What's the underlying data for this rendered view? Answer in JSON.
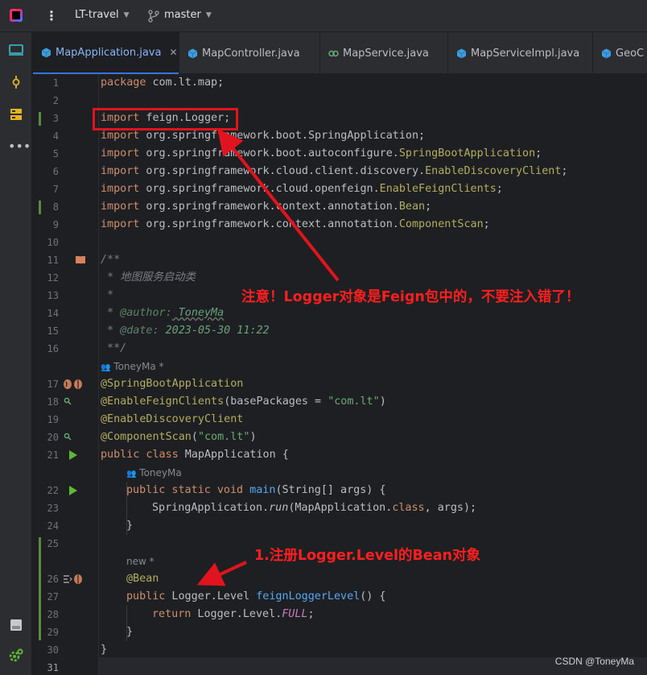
{
  "toolbar": {
    "project": "LT-travel",
    "branch": "master"
  },
  "tabs": [
    {
      "label": "MapApplication.java",
      "icon": "java-class-icon",
      "active": true
    },
    {
      "label": "MapController.java",
      "icon": "java-class-icon",
      "active": false
    },
    {
      "label": "MapService.java",
      "icon": "java-interface-icon",
      "active": false
    },
    {
      "label": "MapServiceImpl.java",
      "icon": "java-class-icon",
      "active": false
    },
    {
      "label": "GeoC",
      "icon": "java-class-icon",
      "active": false
    }
  ],
  "line_numbers": [
    "1",
    "2",
    "3",
    "4",
    "5",
    "6",
    "7",
    "8",
    "9",
    "10",
    "11",
    "12",
    "13",
    "14",
    "15",
    "16",
    "17",
    "18",
    "19",
    "20",
    "21",
    "22",
    "23",
    "24",
    "25",
    "26",
    "27",
    "28",
    "29",
    "30",
    "31"
  ],
  "code": {
    "l1_kw": "package",
    "l1_rest": " com.lt.map;",
    "l3_kw": "import",
    "l3_rest": " feign.Logger;",
    "l4_kw": "import",
    "l4_rest": " org.springframework.boot.SpringApplication;",
    "l5_kw": "import",
    "l5_pre": " org.springframework.boot.autoconfigure.",
    "l5_ann": "SpringBootApplication",
    "l5_end": ";",
    "l6_kw": "import",
    "l6_pre": " org.springframework.cloud.client.discovery.",
    "l6_ann": "EnableDiscoveryClient",
    "l6_end": ";",
    "l7_kw": "import",
    "l7_pre": " org.springframework.cloud.openfeign.",
    "l7_ann": "EnableFeignClients",
    "l7_end": ";",
    "l8_kw": "import",
    "l8_pre": " org.springframework.context.annotation.",
    "l8_ann": "Bean",
    "l8_end": ";",
    "l9_kw": "import",
    "l9_pre": " org.springframework.context.annotation.",
    "l9_ann": "ComponentScan",
    "l9_end": ";",
    "l11": "/**",
    "l12": " * 地图服务启动类",
    "l13": " *",
    "l14_pre": " * ",
    "l14_tag": "@author:",
    "l14_val": " ToneyMa",
    "l15_pre": " * ",
    "l15_tag": "@date:",
    "l15_val": " 2023-05-30 11:22",
    "l16": " **/",
    "inlay_author1": "ToneyMa *",
    "l17": "@SpringBootApplication",
    "l18_ann": "@EnableFeignClients",
    "l18_mid": "(basePackages = ",
    "l18_str": "\"com.lt\"",
    "l18_end": ")",
    "l19": "@EnableDiscoveryClient",
    "l20_ann": "@ComponentScan",
    "l20_mid": "(",
    "l20_str": "\"com.lt\"",
    "l20_end": ")",
    "l21_kw": "public class",
    "l21_rest": " MapApplication {",
    "inlay_author2": "ToneyMa",
    "l22_kw": "public static void",
    "l22_fn": " main",
    "l22_rest": "(String[] args) {",
    "l23_pre": "SpringApplication.",
    "l23_fn": "run",
    "l23_mid": "(MapApplication.",
    "l23_kw": "class",
    "l23_end": ", args);",
    "l24": "}",
    "inlay_new": "new *",
    "l26": "@Bean",
    "l27_kw": "public",
    "l27_mid": " Logger.Level ",
    "l27_fn": "feignLoggerLevel",
    "l27_end": "() {",
    "l28_kw": "return",
    "l28_mid": " Logger.Level.",
    "l28_fld": "FULL",
    "l28_end": ";",
    "l29": "}",
    "l30": "}"
  },
  "annotations": {
    "note1": "注意！Logger对象是Feign包中的，不要注入错了！",
    "note2": "1.注册Logger.Level的Bean对象",
    "color": "#e0141e"
  },
  "watermark": "CSDN @ToneyMa"
}
